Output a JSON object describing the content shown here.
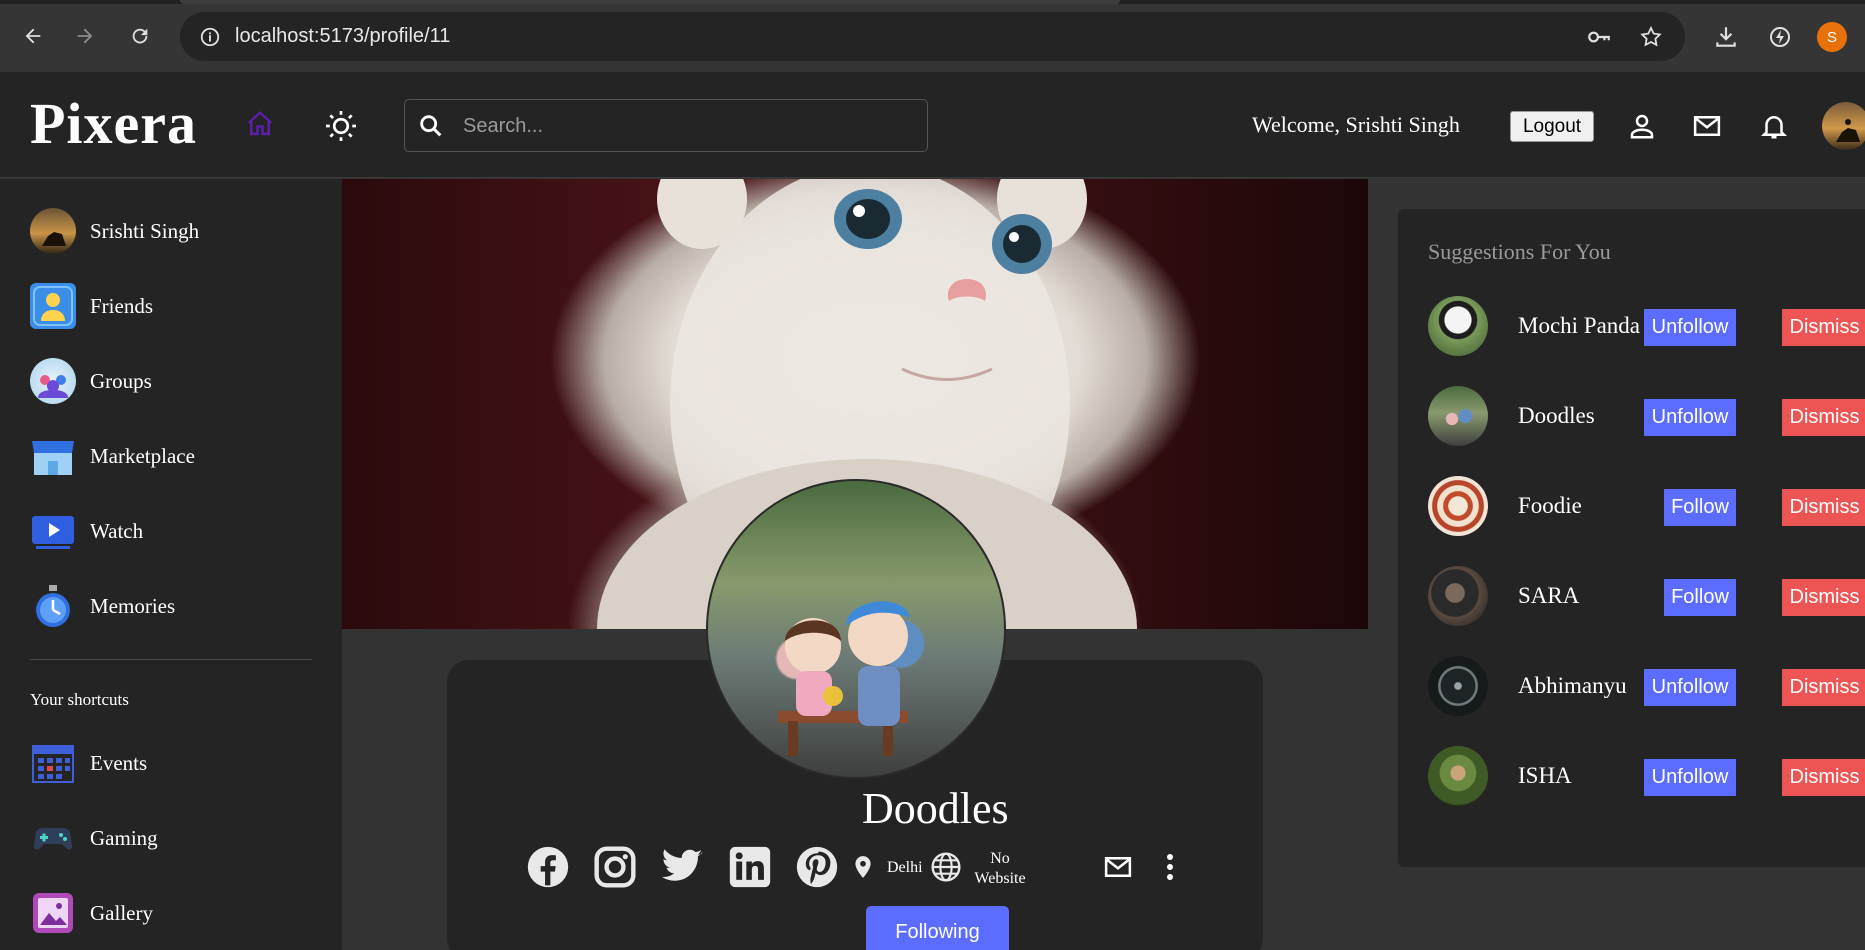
{
  "browser": {
    "url": "localhost:5173/profile/11",
    "profile_initial": "S"
  },
  "header": {
    "logo": "Pixera",
    "search_placeholder": "Search...",
    "welcome": "Welcome, Srishti Singh",
    "logout": "Logout",
    "home_icon_color": "#5b1fa8"
  },
  "sidebar": {
    "items": [
      {
        "label": "Srishti Singh",
        "icon": "user-avatar"
      },
      {
        "label": "Friends",
        "icon": "friends-icon"
      },
      {
        "label": "Groups",
        "icon": "groups-icon"
      },
      {
        "label": "Marketplace",
        "icon": "marketplace-icon"
      },
      {
        "label": "Watch",
        "icon": "watch-icon"
      },
      {
        "label": "Memories",
        "icon": "memories-icon"
      }
    ],
    "shortcuts_title": "Your shortcuts",
    "shortcuts": [
      {
        "label": "Events",
        "icon": "events-icon"
      },
      {
        "label": "Gaming",
        "icon": "gaming-icon"
      },
      {
        "label": "Gallery",
        "icon": "gallery-icon"
      }
    ]
  },
  "profile": {
    "name": "Doodles",
    "location": "Delhi",
    "website_line1": "No",
    "website_line2": "Website",
    "following_label": "Following"
  },
  "suggestions": {
    "title": "Suggestions For You",
    "items": [
      {
        "name": "Mochi Panda",
        "action": "Unfollow",
        "dismiss": "Dismiss"
      },
      {
        "name": "Doodles",
        "action": "Unfollow",
        "dismiss": "Dismiss"
      },
      {
        "name": "Foodie",
        "action": "Follow",
        "dismiss": "Dismiss"
      },
      {
        "name": "SARA",
        "action": "Follow",
        "dismiss": "Dismiss"
      },
      {
        "name": "Abhimanyu",
        "action": "Unfollow",
        "dismiss": "Dismiss"
      },
      {
        "name": "ISHA",
        "action": "Unfollow",
        "dismiss": "Dismiss"
      }
    ]
  },
  "colors": {
    "accent_blue": "#5b6cff",
    "dismiss_red": "#ed5555",
    "panel": "#242424",
    "background": "#333333"
  }
}
